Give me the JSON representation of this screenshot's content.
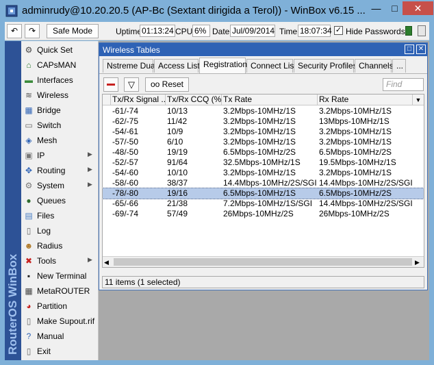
{
  "window": {
    "title": "adminrudy@10.20.20.5 (AP-Bc (Sextant dirigida a Terol)) - WinBox v6.15 ...",
    "minimize_glyph": "—",
    "maximize_glyph": "□",
    "close_glyph": "✕"
  },
  "toolbar": {
    "undo_glyph": "↶",
    "redo_glyph": "↷",
    "safe_mode_label": "Safe Mode",
    "uptime_label": "Uptime:",
    "uptime_value": "01:13:24",
    "cpu_label": "CPU:",
    "cpu_value": "6%",
    "date_label": "Date:",
    "date_value": "Jul/09/2014",
    "time_label": "Time:",
    "time_value": "18:07:34",
    "hide_passwords_label": "Hide Passwords",
    "hide_passwords_checked_glyph": "✓"
  },
  "side_strip_text": "RouterOS WinBox",
  "sidebar": {
    "items": [
      {
        "label": "Quick Set",
        "icon": "quick-set",
        "glyph": "⚙",
        "color": "#444444",
        "submenu": false
      },
      {
        "label": "CAPsMAN",
        "icon": "capsman",
        "glyph": "⌂",
        "color": "#2e7d32",
        "submenu": false
      },
      {
        "label": "Interfaces",
        "icon": "interfaces",
        "glyph": "▬",
        "color": "#3a8a3a",
        "submenu": false
      },
      {
        "label": "Wireless",
        "icon": "wireless",
        "glyph": "≋",
        "color": "#555555",
        "submenu": false
      },
      {
        "label": "Bridge",
        "icon": "bridge",
        "glyph": "▦",
        "color": "#2d62b5",
        "submenu": false
      },
      {
        "label": "Switch",
        "icon": "switch",
        "glyph": "▭",
        "color": "#666666",
        "submenu": false
      },
      {
        "label": "Mesh",
        "icon": "mesh",
        "glyph": "◈",
        "color": "#2d62b5",
        "submenu": false
      },
      {
        "label": "IP",
        "icon": "ip",
        "glyph": "▣",
        "color": "#777777",
        "submenu": true
      },
      {
        "label": "Routing",
        "icon": "routing",
        "glyph": "✥",
        "color": "#2d62b5",
        "submenu": true
      },
      {
        "label": "System",
        "icon": "system",
        "glyph": "⚙",
        "color": "#777777",
        "submenu": true
      },
      {
        "label": "Queues",
        "icon": "queues",
        "glyph": "●",
        "color": "#2e6b2e",
        "submenu": false
      },
      {
        "label": "Files",
        "icon": "files",
        "glyph": "▤",
        "color": "#4a7ec4",
        "submenu": false
      },
      {
        "label": "Log",
        "icon": "log",
        "glyph": "▯",
        "color": "#666666",
        "submenu": false
      },
      {
        "label": "Radius",
        "icon": "radius",
        "glyph": "☻",
        "color": "#b07a2a",
        "submenu": false
      },
      {
        "label": "Tools",
        "icon": "tools",
        "glyph": "✖",
        "color": "#c7211f",
        "submenu": true
      },
      {
        "label": "New Terminal",
        "icon": "terminal",
        "glyph": "▪",
        "color": "#222222",
        "submenu": false
      },
      {
        "label": "MetaROUTER",
        "icon": "metarouter",
        "glyph": "▦",
        "color": "#444444",
        "submenu": false
      },
      {
        "label": "Partition",
        "icon": "partition",
        "glyph": "◕",
        "color": "#c7211f",
        "submenu": false
      },
      {
        "label": "Make Supout.rif",
        "icon": "supout",
        "glyph": "▯",
        "color": "#666666",
        "submenu": false
      },
      {
        "label": "Manual",
        "icon": "manual",
        "glyph": "?",
        "color": "#2d62b5",
        "submenu": false
      },
      {
        "label": "Exit",
        "icon": "exit",
        "glyph": "▯",
        "color": "#666666",
        "submenu": false
      }
    ]
  },
  "wireless_tables": {
    "title": "Wireless Tables",
    "restore_glyph": "□",
    "close_glyph": "✕",
    "tabs": [
      "Nstreme Dual",
      "Access List",
      "Registration",
      "Connect List",
      "Security Profiles",
      "Channels",
      "..."
    ],
    "active_tab": "Registration",
    "filter_glyph": "▽",
    "reset_label": "oo Reset",
    "find_placeholder": "Find",
    "columns": [
      "Tx/Rx Signal ...",
      "Tx/Rx CCQ (%)",
      "Tx Rate",
      "Rx Rate"
    ],
    "rows": [
      [
        "-61/-74",
        "10/13",
        "3.2Mbps-10MHz/1S",
        "3.2Mbps-10MHz/1S"
      ],
      [
        "-62/-75",
        "11/42",
        "3.2Mbps-10MHz/1S",
        "13Mbps-10MHz/1S"
      ],
      [
        "-54/-61",
        "10/9",
        "3.2Mbps-10MHz/1S",
        "3.2Mbps-10MHz/1S"
      ],
      [
        "-57/-50",
        "6/10",
        "3.2Mbps-10MHz/1S",
        "3.2Mbps-10MHz/1S"
      ],
      [
        "-48/-50",
        "19/19",
        "6.5Mbps-10MHz/2S",
        "6.5Mbps-10MHz/2S"
      ],
      [
        "-52/-57",
        "91/64",
        "32.5Mbps-10MHz/1S",
        "19.5Mbps-10MHz/1S"
      ],
      [
        "-54/-60",
        "10/10",
        "3.2Mbps-10MHz/1S",
        "3.2Mbps-10MHz/1S"
      ],
      [
        "-58/-60",
        "38/37",
        "14.4Mbps-10MHz/2S/SGI",
        "14.4Mbps-10MHz/2S/SGI"
      ],
      [
        "-78/-80",
        "19/16",
        "6.5Mbps-10MHz/1S",
        "6.5Mbps-10MHz/2S"
      ],
      [
        "-65/-66",
        "21/38",
        "7.2Mbps-10MHz/1S/SGI",
        "14.4Mbps-10MHz/2S/SGI"
      ],
      [
        "-69/-74",
        "57/49",
        "26Mbps-10MHz/2S",
        "26Mbps-10MHz/2S"
      ]
    ],
    "selected_row": 8,
    "status": "11 items (1 selected)"
  }
}
